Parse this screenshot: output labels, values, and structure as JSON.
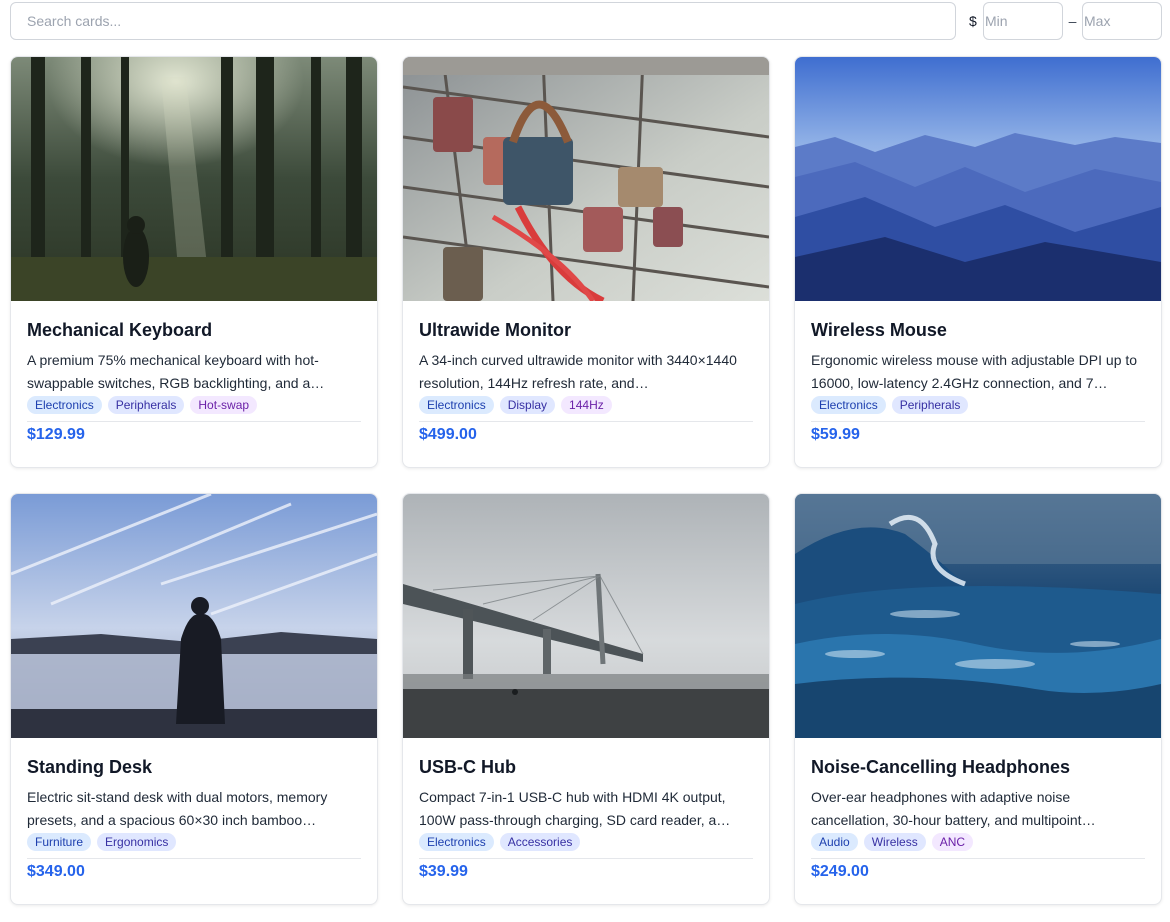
{
  "filters": {
    "search_placeholder": "Search cards...",
    "currency_symbol": "$",
    "min_placeholder": "Min",
    "range_separator": "–",
    "max_placeholder": "Max"
  },
  "cards": [
    {
      "title": "Mechanical Keyboard",
      "description": "A premium 75% mechanical keyboard with hot-swappable switches, RGB backlighting, and a…",
      "tags": [
        "Electronics",
        "Peripherals",
        "Hot-swap"
      ],
      "price": "$129.99",
      "image": "forest-icon"
    },
    {
      "title": "Ultrawide Monitor",
      "description": "A 34-inch curved ultrawide monitor with 3440×1440 resolution, 144Hz refresh rate, and…",
      "tags": [
        "Electronics",
        "Display",
        "144Hz"
      ],
      "price": "$499.00",
      "image": "padlocks-icon"
    },
    {
      "title": "Wireless Mouse",
      "description": "Ergonomic wireless mouse with adjustable DPI up to 16000, low-latency 2.4GHz connection, and 7…",
      "tags": [
        "Electronics",
        "Peripherals"
      ],
      "price": "$59.99",
      "image": "mountains-icon"
    },
    {
      "title": "Standing Desk",
      "description": "Electric sit-stand desk with dual motors, memory presets, and a spacious 60×30 inch bamboo…",
      "tags": [
        "Furniture",
        "Ergonomics"
      ],
      "price": "$349.00",
      "image": "lake-silhouette-icon"
    },
    {
      "title": "USB-C Hub",
      "description": "Compact 7-in-1 USB-C hub with HDMI 4K output, 100W pass-through charging, SD card reader, a…",
      "tags": [
        "Electronics",
        "Accessories"
      ],
      "price": "$39.99",
      "image": "foggy-bridge-icon"
    },
    {
      "title": "Noise-Cancelling Headphones",
      "description": "Over-ear headphones with adaptive noise cancellation, 30-hour battery, and multipoint…",
      "tags": [
        "Audio",
        "Wireless",
        "ANC"
      ],
      "price": "$249.00",
      "image": "ocean-wave-icon"
    }
  ]
}
